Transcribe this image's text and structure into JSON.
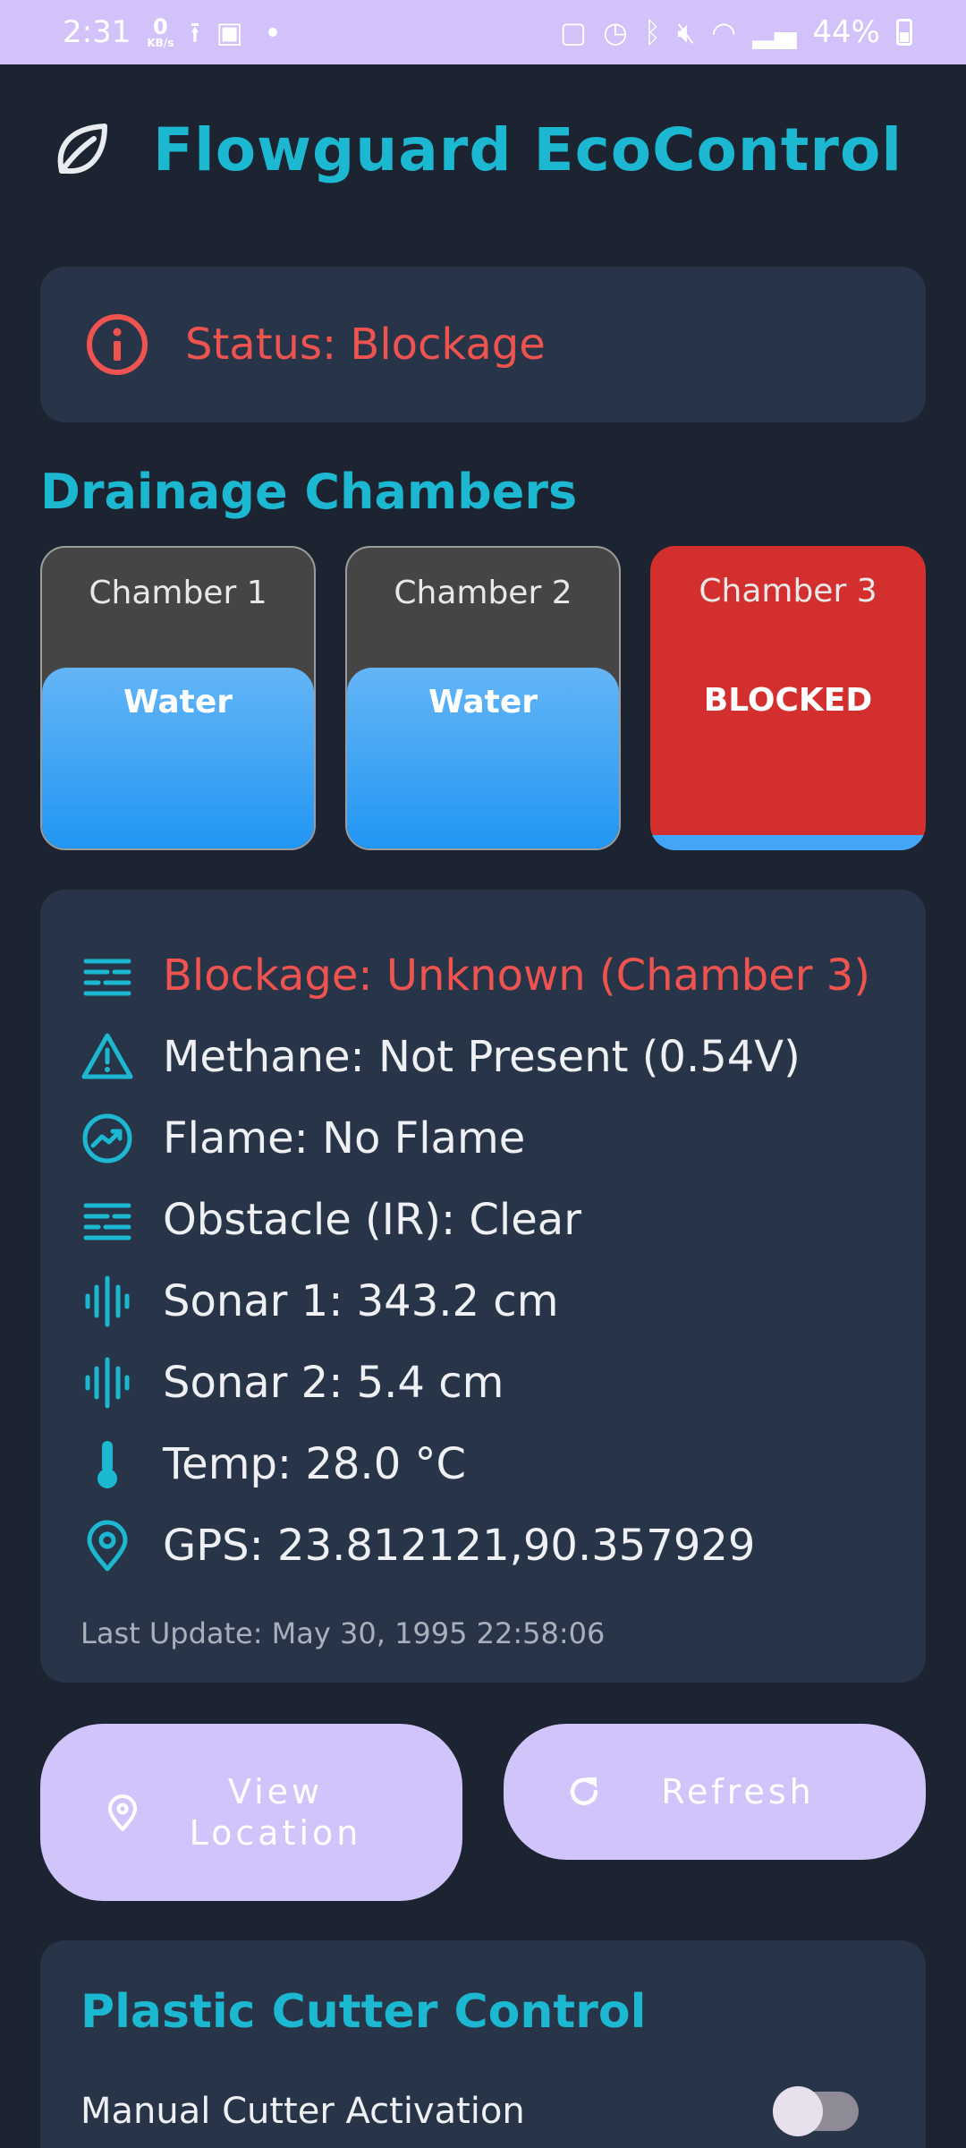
{
  "status_bar": {
    "time": "2:31",
    "net_speed_value": "0",
    "net_speed_unit": "KB/s",
    "battery": "44%",
    "icons": [
      "upload-icon",
      "screen-icon",
      "battery-saver-icon",
      "alarm-icon",
      "bluetooth-icon",
      "mute-icon",
      "wifi-icon",
      "signal-icon",
      "battery-icon"
    ]
  },
  "header": {
    "title": "Flowguard EcoControl",
    "icon": "leaf-icon"
  },
  "status": {
    "text": "Status: Blockage",
    "icon": "info-icon",
    "color": "#ef5350"
  },
  "chambers_section": {
    "title": "Drainage Chambers",
    "chambers": [
      {
        "name": "Chamber 1",
        "state": "Water",
        "level": 0.6,
        "blocked": false
      },
      {
        "name": "Chamber 2",
        "state": "Water",
        "level": 0.6,
        "blocked": false
      },
      {
        "name": "Chamber 3",
        "state": "BLOCKED",
        "level": 0.05,
        "blocked": true
      }
    ]
  },
  "sensors": {
    "rows": [
      {
        "icon": "filter-lines-icon",
        "text": "Blockage: Unknown (Chamber 3)",
        "alert": true
      },
      {
        "icon": "warning-triangle-icon",
        "text": "Methane: Not Present (0.54V)",
        "alert": false
      },
      {
        "icon": "trending-up-icon",
        "text": "Flame: No Flame",
        "alert": false
      },
      {
        "icon": "filter-lines-icon",
        "text": "Obstacle (IR): Clear",
        "alert": false
      },
      {
        "icon": "sound-wave-icon",
        "text": "Sonar 1: 343.2 cm",
        "alert": false
      },
      {
        "icon": "sound-wave-icon",
        "text": "Sonar 2: 5.4 cm",
        "alert": false
      },
      {
        "icon": "thermometer-icon",
        "text": "Temp: 28.0 °C",
        "alert": false
      },
      {
        "icon": "location-pin-icon",
        "text": "GPS: 23.812121,90.357929",
        "alert": false
      }
    ],
    "last_update": "Last Update: May 30, 1995 22:58:06"
  },
  "actions": {
    "view_location": "View\nLocation",
    "refresh": "Refresh"
  },
  "cutter": {
    "title": "Plastic Cutter Control",
    "manual_label": "Manual Cutter Activation",
    "manual_enabled": false
  },
  "colors": {
    "accent": "#1cb8d1",
    "alert": "#ef5350",
    "background": "#1c2431",
    "card": "#283548",
    "button": "#d1c4fa",
    "water": "#2196f3",
    "blocked": "#d32f2f"
  }
}
